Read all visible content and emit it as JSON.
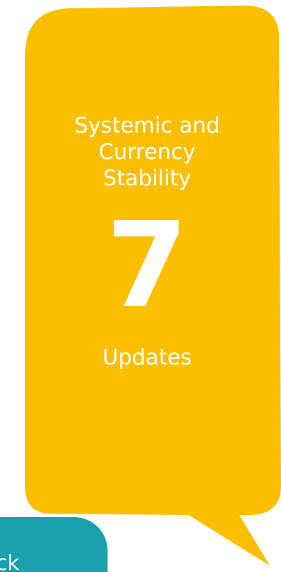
{
  "card": {
    "title_lines": [
      "Systemic and",
      "Currency",
      "Stability"
    ],
    "count": "7",
    "subtitle": "Updates"
  },
  "teal_card": {
    "text_fragment": "ck"
  },
  "colors": {
    "bubble": "#fcbf00",
    "teal": "#1aa0ae",
    "text": "#ffffff"
  }
}
